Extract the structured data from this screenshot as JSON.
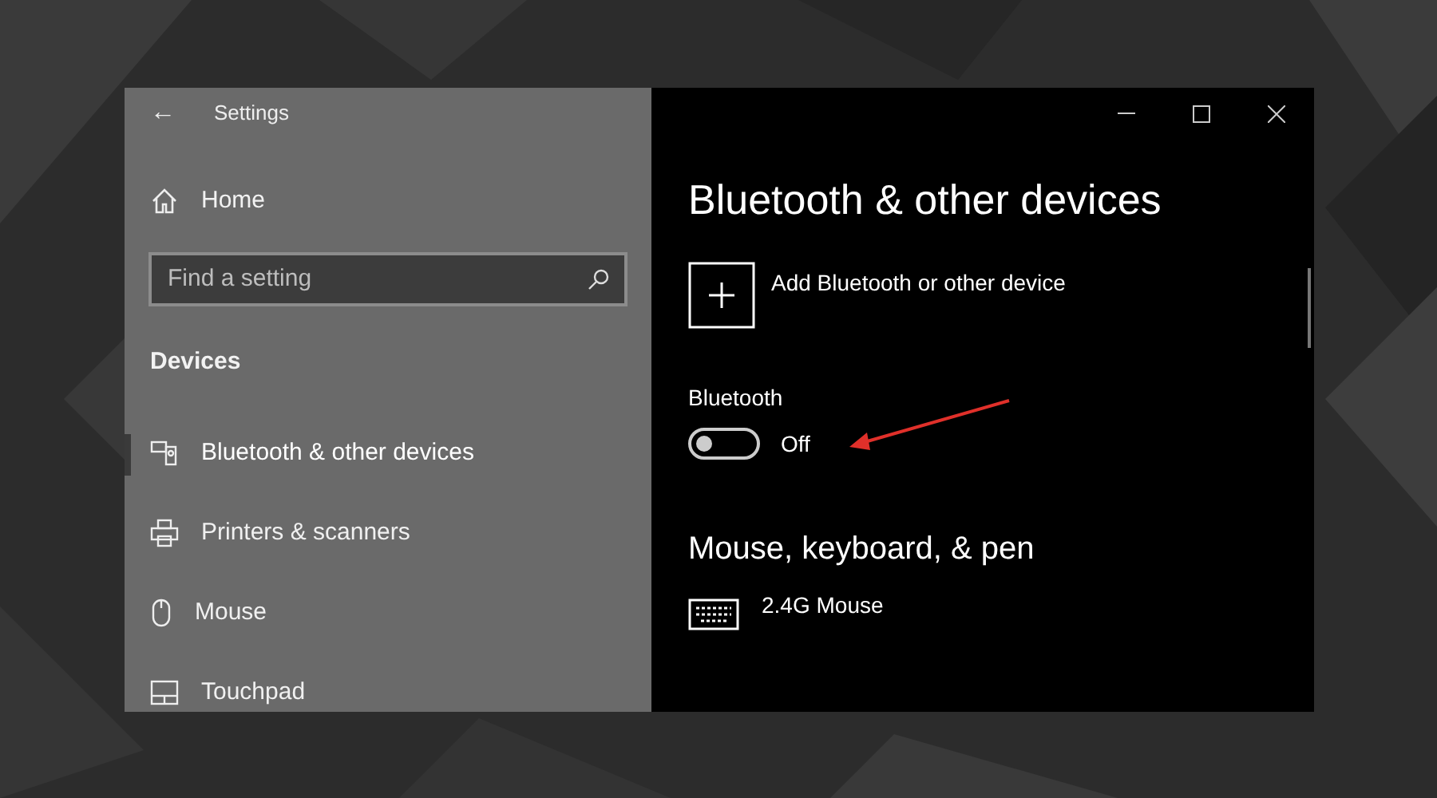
{
  "window": {
    "title": "Settings",
    "back": "←"
  },
  "sidebar": {
    "home": "Home",
    "search": {
      "placeholder": "Find a setting"
    },
    "section": "Devices",
    "items": [
      {
        "label": "Bluetooth & other devices",
        "kind": "bluetooth",
        "selected": true
      },
      {
        "label": "Printers & scanners",
        "kind": "printer",
        "selected": false
      },
      {
        "label": "Mouse",
        "kind": "mouse",
        "selected": false
      },
      {
        "label": "Touchpad",
        "kind": "touchpad",
        "selected": false
      }
    ]
  },
  "content": {
    "heading": "Bluetooth & other devices",
    "add_device": "Add Bluetooth or other device",
    "bluetooth": {
      "label": "Bluetooth",
      "on": false,
      "state": "Off"
    },
    "section": "Mouse, keyboard, & pen",
    "devices": [
      {
        "name": "2.4G Mouse",
        "kind": "keyboard"
      }
    ]
  }
}
